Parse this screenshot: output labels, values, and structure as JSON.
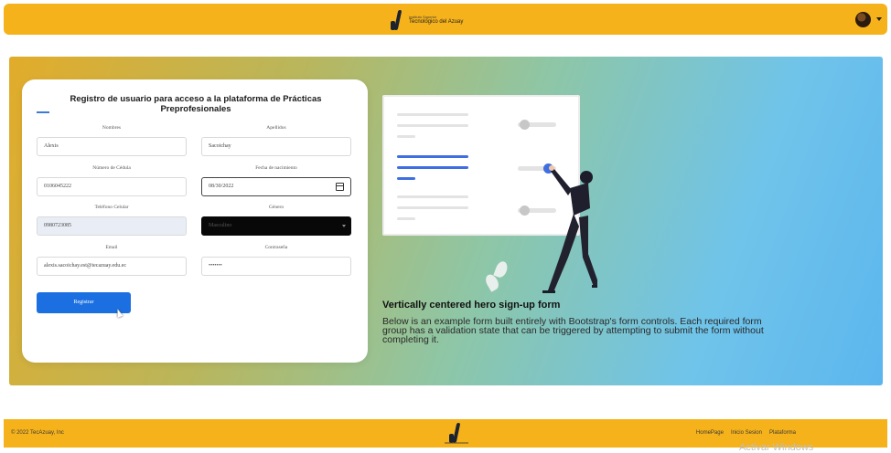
{
  "header": {
    "brand_small": "Instituto Superior",
    "brand_main": "Tecnológico del Azuay"
  },
  "form": {
    "title": "Registro de usuario para acceso a la plataforma de Prácticas Preprofesionales",
    "fields": {
      "nombres": {
        "label": "Nombres",
        "value": "Alexis"
      },
      "apellidos": {
        "label": "Apellidos",
        "value": "Sacoichay"
      },
      "cedula": {
        "label": "Número de Cédula",
        "value": "0106045222"
      },
      "fecha": {
        "label": "Fecha de nacimiento",
        "value": "08/30/2022"
      },
      "telefono": {
        "label": "Teléfono Celular",
        "value": "0980723085"
      },
      "genero": {
        "label": "Género",
        "value": "Masculino"
      },
      "email": {
        "label": "Email",
        "value": "alexis.sacoichay.est@tecazuay.edu.ec"
      },
      "contrasena": {
        "label": "Contraseña",
        "value": "•••••••"
      }
    },
    "submit_label": "Registrar"
  },
  "hero": {
    "title": "Vertically centered hero sign-up form",
    "text": "Below is an example form built entirely with Bootstrap's form controls. Each required form group has a validation state that can be triggered by attempting to submit the form without completing it."
  },
  "footer": {
    "copyright": "© 2022 TecAzuay, Inc",
    "links": [
      "HomePage",
      "Inicio Sesion",
      "Plataforma"
    ]
  },
  "watermark": "Activar Windows",
  "colors": {
    "navbar": "#f6b21a",
    "primary_button": "#1b6fe0"
  }
}
